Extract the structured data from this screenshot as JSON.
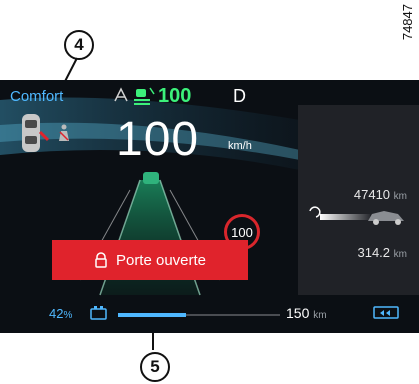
{
  "diagram_id": "74847",
  "callouts": {
    "c4": "4",
    "c5": "5"
  },
  "dashboard": {
    "drive_mode": "Comfort",
    "speed_limit_assist": "100",
    "gear": "D",
    "speed": "100",
    "speed_unit": "km/h",
    "odometer": "47410",
    "odometer_unit": "km",
    "range": "314.2",
    "range_unit": "km",
    "speed_limit_sign": "100",
    "alert_text": "Porte ouverte",
    "battery_percent": "42",
    "battery_percent_unit": "%",
    "battery_range": "150",
    "battery_range_unit": "km",
    "battery_level": 0.42
  },
  "colors": {
    "background": "#0b0f14",
    "accent_blue": "#4fb8ff",
    "assist_green": "#3cf07a",
    "alert_red": "#e0232c",
    "limit_ring": "#d9262c"
  },
  "icons": [
    "open-door-car-icon",
    "seatbelt-icon",
    "lane-keep-icon",
    "speed-limiter-icon",
    "car-range-icon",
    "eco-arrow-icon",
    "battery-icon",
    "regen-icon",
    "door-lock-alert-icon"
  ]
}
